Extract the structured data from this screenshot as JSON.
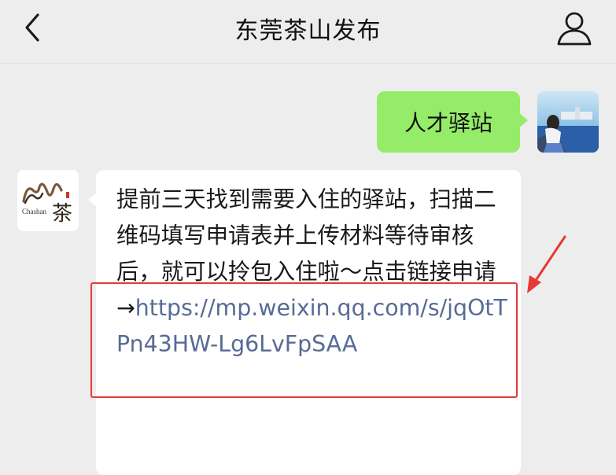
{
  "header": {
    "back_icon": "chevron-left-icon",
    "title": "东莞茶山发布",
    "profile_icon": "person-icon"
  },
  "messages": [
    {
      "direction": "outgoing",
      "text": "人才驿站"
    },
    {
      "direction": "incoming",
      "sender_logo_text": "Chashan",
      "text": "提前三天找到需要入住的驿站，扫描二维码填写申请表并上传材料等待审核后，就可以拎包入住啦～点击链接申请 →",
      "link": "https://mp.weixin.qq.com/s/jqOtTPn43HW-Lg6LvFpSAA"
    }
  ],
  "annotation": {
    "highlight_color": "#e53a36"
  },
  "colors": {
    "outgoing_bubble": "#95ec69",
    "link": "#576b95",
    "background": "#ededed"
  }
}
